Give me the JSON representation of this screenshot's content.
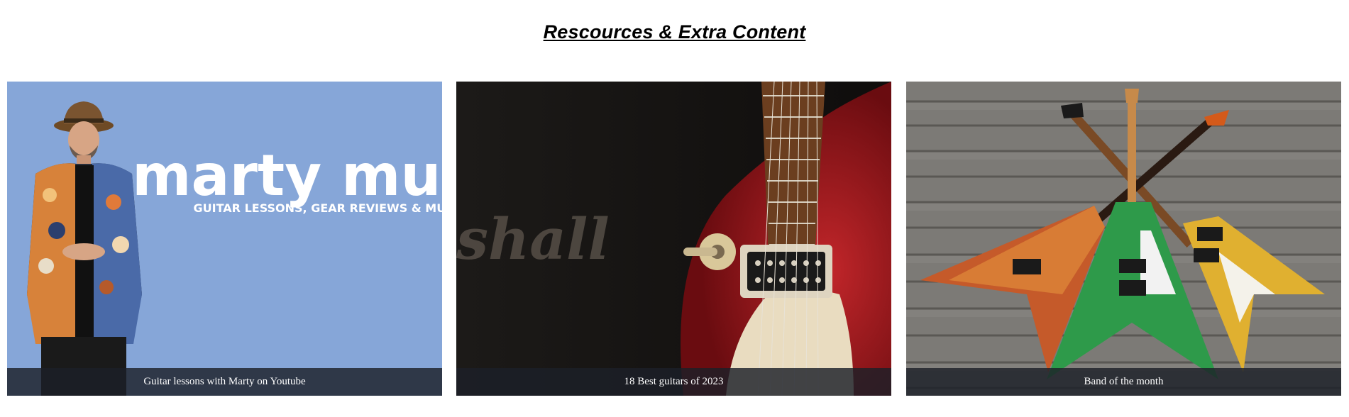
{
  "section": {
    "title": "Rescources & Extra Content"
  },
  "cards": [
    {
      "caption": "Guitar lessons with Marty on Youtube",
      "banner": {
        "name": "marty music",
        "tagline": "GUITAR LESSONS, GEAR REVIEWS & MUSIC",
        "background": "#86a6d8"
      }
    },
    {
      "caption": "18 Best guitars of 2023",
      "amp_logo_text": "shall"
    },
    {
      "caption": "Band of the month"
    }
  ]
}
